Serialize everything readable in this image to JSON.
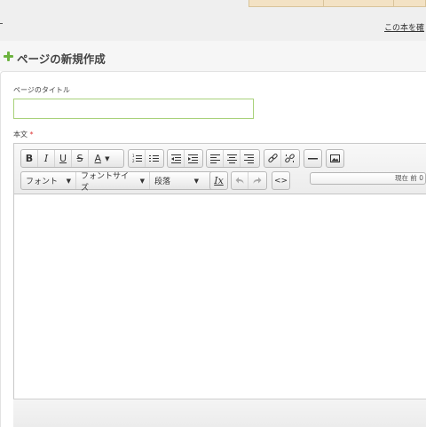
{
  "header": {
    "top_link": "この本を確"
  },
  "page": {
    "title": "ページの新規作成"
  },
  "form": {
    "title_label": "ページのタイトル",
    "title_value": "",
    "body_label": "本文",
    "required_mark": "*"
  },
  "toolbar": {
    "row1": {
      "bold": "B",
      "italic": "I",
      "underline": "U",
      "strike": "S",
      "font_color": "A"
    },
    "row2": {
      "font_family": "フォント",
      "font_size": "フォントサイズ",
      "paragraph": "段落",
      "clear_format": "Ix",
      "source_code": "<>"
    }
  },
  "status": {
    "text": "現在 前 0"
  },
  "icons": [
    "plus-icon",
    "ordered-list-icon",
    "bullet-list-icon",
    "outdent-icon",
    "indent-icon",
    "align-left-icon",
    "align-center-icon",
    "align-right-icon",
    "link-icon",
    "unlink-icon",
    "horizontal-rule-icon",
    "image-icon",
    "undo-icon",
    "redo-icon",
    "code-icon",
    "chevron-down-icon"
  ],
  "colors": {
    "accent_green": "#6cb33f",
    "input_border": "#a8d17a",
    "required": "#dd3333"
  }
}
